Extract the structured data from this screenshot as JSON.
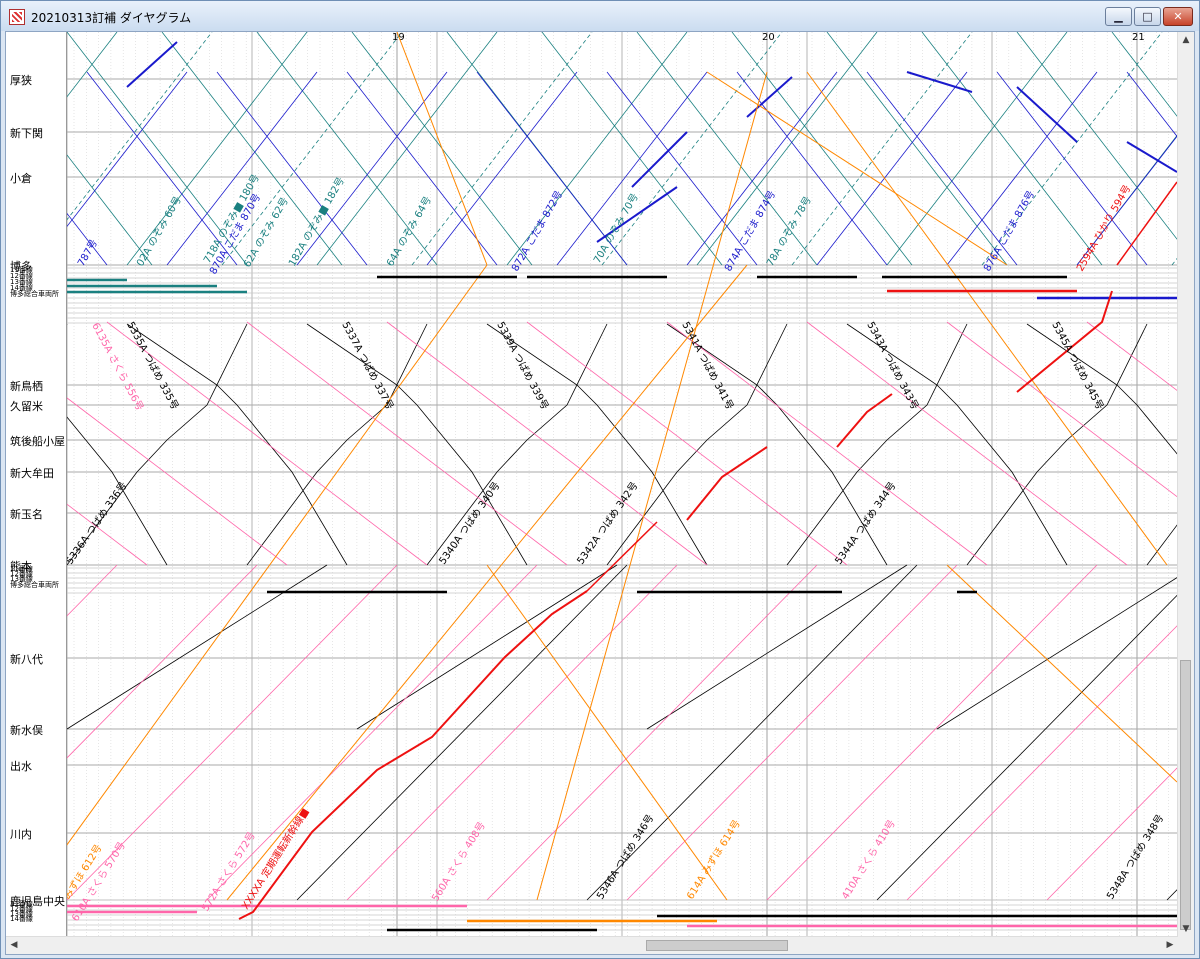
{
  "window": {
    "title": "20210313訂補 ダイヤグラム",
    "minimize_glyph": "▁",
    "maximize_glyph": "□",
    "close_glyph": "✕"
  },
  "hours": [
    "19",
    "20",
    "21"
  ],
  "stations": [
    "厚狭",
    "新下関",
    "小倉",
    "博多",
    "新鳥栖",
    "久留米",
    "筑後船小屋",
    "新大牟田",
    "新玉名",
    "熊本",
    "新八代",
    "新水俣",
    "出水",
    "川内",
    "鹿児島中央"
  ],
  "track_labels": [
    "11番線",
    "12番線",
    "13番線",
    "14番線",
    "博多総合車両所"
  ],
  "colors": {
    "kodama": "#1a1acc",
    "nozomi": "#1a8080",
    "tsubame": "#000000",
    "sakura": "#ff66aa",
    "mizuho": "#ff8800",
    "special": "#ee1111",
    "grid": "#bbbbbb"
  },
  "train_labels_upper": [
    "787号",
    "02A のぞみ 60号",
    "718A のぞみ■ 180号",
    "870A こだま 870号",
    "62A のぞみ 62号",
    "182A のぞみ■ 182号",
    "64A のぞみ 64号",
    "872A こだま 872号",
    "70A のぞみ 70号",
    "874A こだま 874号",
    "78A のぞみ 78号",
    "876A こだま 876号",
    "2594A ひかり 594号"
  ],
  "train_labels_middle": [
    "6135A さくら 556号",
    "5335A つばめ 335号",
    "5337A つばめ 337号",
    "5339A つばめ 339号",
    "5341A つばめ 341号",
    "5343A つばめ 343号",
    "5345A つばめ 345号",
    "5336A つばめ 336号",
    "5340A つばめ 340号",
    "5342A つばめ 342号",
    "5344A つばめ 344号"
  ],
  "train_labels_lower": [
    "みずほ 612号",
    "610A さくら 570号",
    "572A さくら 572号",
    "XXXXA 定期運転新幹線■",
    "560A さくら 408号",
    "5346A つばめ 346号",
    "614A みずほ 614号",
    "410A さくら 410号",
    "5348A つばめ 348号"
  ]
}
